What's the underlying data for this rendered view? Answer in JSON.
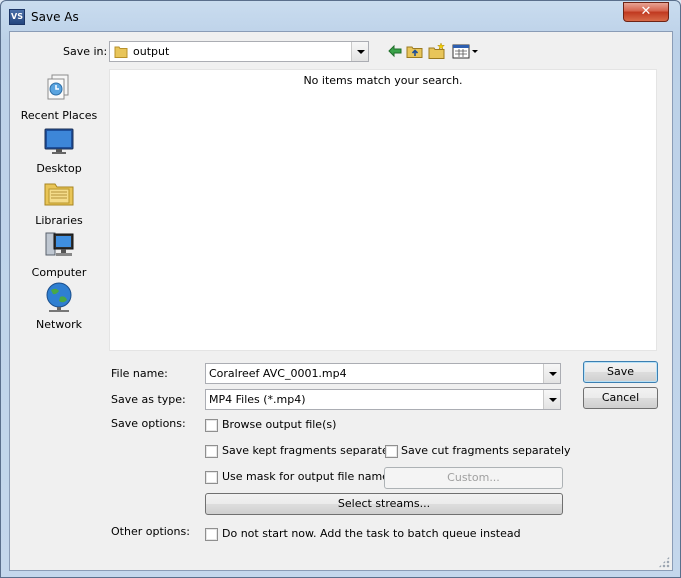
{
  "window": {
    "title": "Save As",
    "app_icon_text": "VS",
    "close_glyph": "✕"
  },
  "top": {
    "save_in_label": "Save in:",
    "save_in_value": "output"
  },
  "places": [
    {
      "label": "Recent Places",
      "icon": "recent-places-icon"
    },
    {
      "label": "Desktop",
      "icon": "desktop-icon"
    },
    {
      "label": "Libraries",
      "icon": "libraries-icon"
    },
    {
      "label": "Computer",
      "icon": "computer-icon"
    },
    {
      "label": "Network",
      "icon": "network-icon"
    }
  ],
  "file_list": {
    "empty_message": "No items match your search."
  },
  "form": {
    "file_name_label": "File name:",
    "file_name_value": "Coralreef AVC_0001.mp4",
    "save_type_label": "Save as type:",
    "save_type_value": "MP4 Files (*.mp4)",
    "save_options_label": "Save options:",
    "browse_output": "Browse output file(s)",
    "save_kept": "Save kept fragments separately",
    "save_cut": "Save cut fragments separately",
    "use_mask": "Use mask for output file names",
    "custom_button": "Custom...",
    "select_streams_button": "Select streams...",
    "other_options_label": "Other options:",
    "batch_queue": "Do not start now. Add the task to batch queue instead"
  },
  "buttons": {
    "save": "Save",
    "cancel": "Cancel"
  },
  "checkboxes": {
    "browse_output": false,
    "save_kept": false,
    "save_cut": false,
    "use_mask": false,
    "batch_queue": false
  },
  "colors": {
    "titlebar": "#c9dcef",
    "close": "#c7452c",
    "client": "#f0f0f0"
  }
}
